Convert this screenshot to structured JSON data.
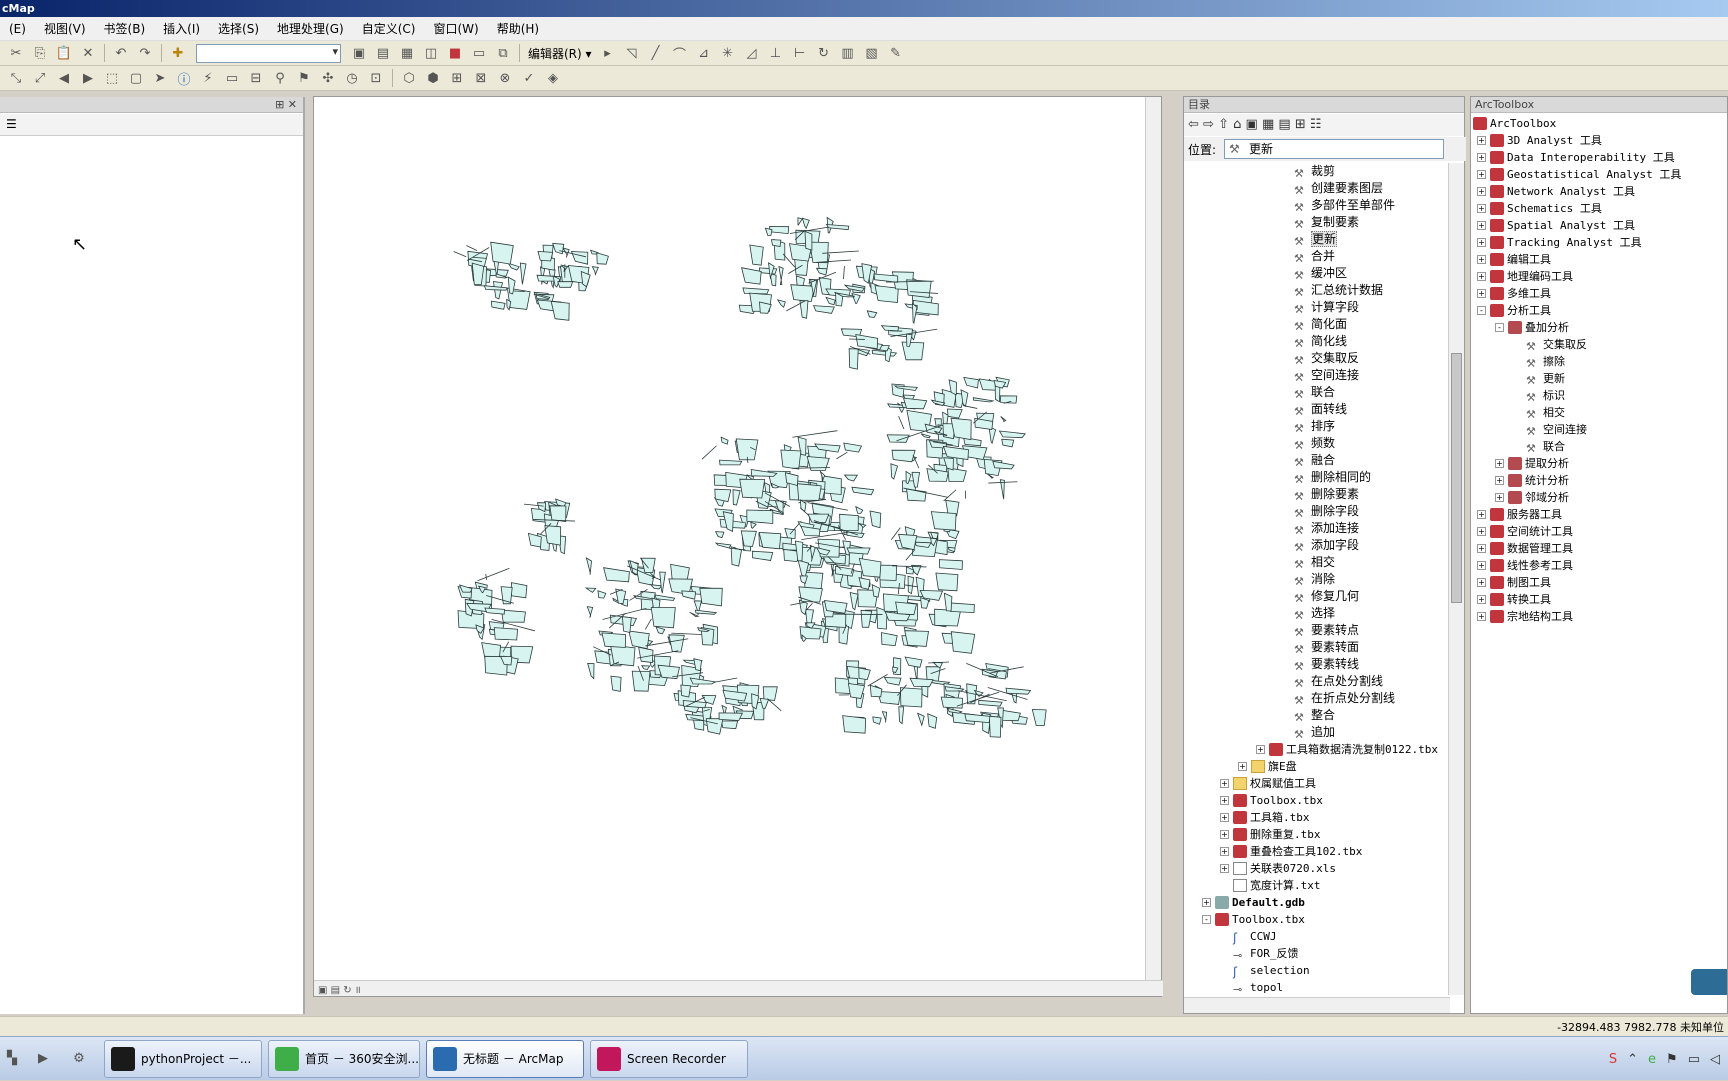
{
  "window": {
    "title": "cMap"
  },
  "menu": [
    "(E)",
    "视图(V)",
    "书签(B)",
    "插入(I)",
    "选择(S)",
    "地理处理(G)",
    "自定义(C)",
    "窗口(W)",
    "帮助(H)"
  ],
  "toolbar": {
    "editor_label": "编辑器(R) ▾"
  },
  "catalog": {
    "title": "目录",
    "location_label": "位置:",
    "location_value": "更新",
    "tools": [
      "裁剪",
      "创建要素图层",
      "多部件至单部件",
      "复制要素",
      "更新",
      "合并",
      "缓冲区",
      "汇总统计数据",
      "计算字段",
      "简化面",
      "简化线",
      "交集取反",
      "空间连接",
      "联合",
      "面转线",
      "排序",
      "频数",
      "融合",
      "删除相同的",
      "删除要素",
      "删除字段",
      "添加连接",
      "添加字段",
      "相交",
      "消除",
      "修复几何",
      "选择",
      "要素转点",
      "要素转面",
      "要素转线",
      "在点处分割线",
      "在折点处分割线",
      "整合",
      "追加"
    ],
    "items": [
      {
        "label": "工具箱数据清洗复制0122.tbx",
        "type": "toolbox",
        "indent": 4,
        "exp": "+"
      },
      {
        "label": "旗E盘",
        "type": "folder",
        "indent": 3,
        "exp": "+"
      },
      {
        "label": "权属赋值工具",
        "type": "folder",
        "indent": 2,
        "exp": "+"
      },
      {
        "label": "Toolbox.tbx",
        "type": "toolbox",
        "indent": 2,
        "exp": "+"
      },
      {
        "label": "工具箱.tbx",
        "type": "toolbox",
        "indent": 2,
        "exp": "+"
      },
      {
        "label": "删除重复.tbx",
        "type": "toolbox",
        "indent": 2,
        "exp": "+"
      },
      {
        "label": "重叠检查工具102.tbx",
        "type": "toolbox",
        "indent": 2,
        "exp": "+"
      },
      {
        "label": "关联表0720.xls",
        "type": "file",
        "indent": 2,
        "exp": "+"
      },
      {
        "label": "宽度计算.txt",
        "type": "file",
        "indent": 2,
        "exp": ""
      },
      {
        "label": "Default.gdb",
        "type": "gdb",
        "indent": 1,
        "exp": "+"
      },
      {
        "label": "Toolbox.tbx",
        "type": "toolbox",
        "indent": 1,
        "exp": "-"
      },
      {
        "label": "CCWJ",
        "type": "script",
        "indent": 2,
        "exp": ""
      },
      {
        "label": "FOR_反馈",
        "type": "model",
        "indent": 2,
        "exp": ""
      },
      {
        "label": "selection",
        "type": "script",
        "indent": 2,
        "exp": ""
      },
      {
        "label": "topol",
        "type": "model",
        "indent": 2,
        "exp": ""
      }
    ]
  },
  "arctoolbox": {
    "title": "ArcToolbox",
    "root": "ArcToolbox",
    "items": [
      {
        "label": "3D Analyst 工具",
        "indent": 1,
        "exp": "+",
        "kind": "tb"
      },
      {
        "label": "Data Interoperability 工具",
        "indent": 1,
        "exp": "+",
        "kind": "tb"
      },
      {
        "label": "Geostatistical Analyst 工具",
        "indent": 1,
        "exp": "+",
        "kind": "tb"
      },
      {
        "label": "Network Analyst 工具",
        "indent": 1,
        "exp": "+",
        "kind": "tb"
      },
      {
        "label": "Schematics 工具",
        "indent": 1,
        "exp": "+",
        "kind": "tb"
      },
      {
        "label": "Spatial Analyst 工具",
        "indent": 1,
        "exp": "+",
        "kind": "tb"
      },
      {
        "label": "Tracking Analyst 工具",
        "indent": 1,
        "exp": "+",
        "kind": "tb"
      },
      {
        "label": "编辑工具",
        "indent": 1,
        "exp": "+",
        "kind": "tb"
      },
      {
        "label": "地理编码工具",
        "indent": 1,
        "exp": "+",
        "kind": "tb"
      },
      {
        "label": "多维工具",
        "indent": 1,
        "exp": "+",
        "kind": "tb"
      },
      {
        "label": "分析工具",
        "indent": 1,
        "exp": "-",
        "kind": "tb"
      },
      {
        "label": "叠加分析",
        "indent": 2,
        "exp": "-",
        "kind": "ts"
      },
      {
        "label": "交集取反",
        "indent": 3,
        "exp": "",
        "kind": "tool"
      },
      {
        "label": "擦除",
        "indent": 3,
        "exp": "",
        "kind": "tool"
      },
      {
        "label": "更新",
        "indent": 3,
        "exp": "",
        "kind": "tool"
      },
      {
        "label": "标识",
        "indent": 3,
        "exp": "",
        "kind": "tool"
      },
      {
        "label": "相交",
        "indent": 3,
        "exp": "",
        "kind": "tool"
      },
      {
        "label": "空间连接",
        "indent": 3,
        "exp": "",
        "kind": "tool"
      },
      {
        "label": "联合",
        "indent": 3,
        "exp": "",
        "kind": "tool"
      },
      {
        "label": "提取分析",
        "indent": 2,
        "exp": "+",
        "kind": "ts"
      },
      {
        "label": "统计分析",
        "indent": 2,
        "exp": "+",
        "kind": "ts"
      },
      {
        "label": "邻域分析",
        "indent": 2,
        "exp": "+",
        "kind": "ts"
      },
      {
        "label": "服务器工具",
        "indent": 1,
        "exp": "+",
        "kind": "tb"
      },
      {
        "label": "空间统计工具",
        "indent": 1,
        "exp": "+",
        "kind": "tb"
      },
      {
        "label": "数据管理工具",
        "indent": 1,
        "exp": "+",
        "kind": "tb"
      },
      {
        "label": "线性参考工具",
        "indent": 1,
        "exp": "+",
        "kind": "tb"
      },
      {
        "label": "制图工具",
        "indent": 1,
        "exp": "+",
        "kind": "tb"
      },
      {
        "label": "转换工具",
        "indent": 1,
        "exp": "+",
        "kind": "tb"
      },
      {
        "label": "宗地结构工具",
        "indent": 1,
        "exp": "+",
        "kind": "tb"
      }
    ]
  },
  "status": {
    "coords": "-32894.483   7982.778 未知单位"
  },
  "taskbar": [
    {
      "label": "pythonProject －...",
      "color": "#1a1a1a"
    },
    {
      "label": "首页 － 360安全浏...",
      "color": "#3fae49"
    },
    {
      "label": "无标题 － ArcMap",
      "color": "#2b6cb0"
    },
    {
      "label": "Screen Recorder",
      "color": "#c2185b"
    }
  ],
  "colors": {
    "polygon_fill": "#d7f4f1",
    "polygon_stroke": "#2a3a3a",
    "toolbox_red": "#c0363c"
  }
}
